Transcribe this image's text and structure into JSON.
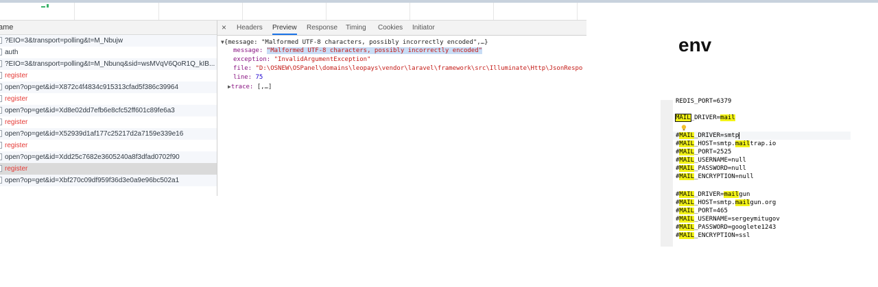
{
  "devtools": {
    "column_header": "ame",
    "requests": [
      {
        "name": "?EIO=3&transport=polling&t=M_Nbujw",
        "status": "normal"
      },
      {
        "name": "auth",
        "status": "normal"
      },
      {
        "name": "?EIO=3&transport=polling&t=M_Nbunq&sid=wsMVqV6QoR1Q_kIB...",
        "status": "normal"
      },
      {
        "name": "register",
        "status": "error"
      },
      {
        "name": "open?op=get&id=X872c4f4834c915313cfad5f386c39964",
        "status": "normal"
      },
      {
        "name": "register",
        "status": "error"
      },
      {
        "name": "open?op=get&id=Xd8e02dd7efb6e8cfc52ff601c89fe6a3",
        "status": "normal"
      },
      {
        "name": "register",
        "status": "error"
      },
      {
        "name": "open?op=get&id=X52939d1af177c25217d2a7159e339e16",
        "status": "normal"
      },
      {
        "name": "register",
        "status": "error"
      },
      {
        "name": "open?op=get&id=Xdd25c7682e3605240a8f3dfad0702f90",
        "status": "normal"
      },
      {
        "name": "register",
        "status": "error-selected"
      },
      {
        "name": "open?op=get&id=Xbf270c09df959f36d3e0a9e96bc502a1",
        "status": "normal"
      }
    ],
    "tabs": {
      "close": "×",
      "headers": "Headers",
      "preview": "Preview",
      "response": "Response",
      "timing": "Timing",
      "cookies": "Cookies",
      "initiator": "Initiator",
      "active": "Preview"
    },
    "preview": {
      "summary": "{message: \"Malformed UTF-8 characters, possibly incorrectly encoded\",…}",
      "message_key": "message:",
      "message_val": "\"Malformed UTF-8 characters, possibly incorrectly encoded\"",
      "exception_key": "exception:",
      "exception_val": "\"InvalidArgumentException\"",
      "file_key": "file:",
      "file_val": "\"D:\\OSNEW\\OSPanel\\domains\\leopays\\vendor\\laravel\\framework\\src\\Illuminate\\Http\\JsonRespo",
      "line_key": "line:",
      "line_val": "75",
      "trace_key": "trace:",
      "trace_val": "[,…]"
    }
  },
  "env": {
    "title": "env",
    "lines": [
      {
        "pre": "",
        "hl": "",
        "post": "REDIS_PORT=6379"
      },
      {
        "pre": "",
        "hl": "MAIL",
        "post": "_DRIVER=",
        "hl2": "mail",
        "post2": ""
      },
      {
        "pre": "",
        "hl": "",
        "post": ""
      },
      {
        "pre": "#",
        "hl": "MAIL",
        "post": "_DRIVER=smtp",
        "hl2": "",
        "post2": ""
      },
      {
        "pre": "#",
        "hl": "MAIL",
        "post": "_HOST=smtp.",
        "hl2": "mail",
        "post2": "trap.io"
      },
      {
        "pre": "#",
        "hl": "MAIL",
        "post": "_PORT=2525",
        "hl2": "",
        "post2": ""
      },
      {
        "pre": "#",
        "hl": "MAIL",
        "post": "_USERNAME=null",
        "hl2": "",
        "post2": ""
      },
      {
        "pre": "#",
        "hl": "MAIL",
        "post": "_PASSWORD=null",
        "hl2": "",
        "post2": ""
      },
      {
        "pre": "#",
        "hl": "MAIL",
        "post": "_ENCRYPTION=null",
        "hl2": "",
        "post2": ""
      },
      {
        "pre": "",
        "hl": "",
        "post": ""
      },
      {
        "pre": "#",
        "hl": "MAIL",
        "post": "_DRIVER=",
        "hl2": "mail",
        "post2": "gun"
      },
      {
        "pre": "#",
        "hl": "MAIL",
        "post": "_HOST=smtp.",
        "hl2": "mail",
        "post2": "gun.org"
      },
      {
        "pre": "#",
        "hl": "MAIL",
        "post": "_PORT=465",
        "hl2": "",
        "post2": ""
      },
      {
        "pre": "#",
        "hl": "MAIL",
        "post": "_USERNAME=sergeymitugov",
        "hl2": "",
        "post2": ""
      },
      {
        "pre": "#",
        "hl": "MAIL",
        "post": "_PASSWORD=googlete1243",
        "hl2": "",
        "post2": ""
      },
      {
        "pre": "#",
        "hl": "MAIL",
        "post": "_ENCRYPTION=ssl",
        "hl2": "",
        "post2": ""
      }
    ]
  },
  "colors": {
    "error_text": "#e53935",
    "tab_underline": "#1a73e8",
    "search_highlight": "#f3f318"
  }
}
